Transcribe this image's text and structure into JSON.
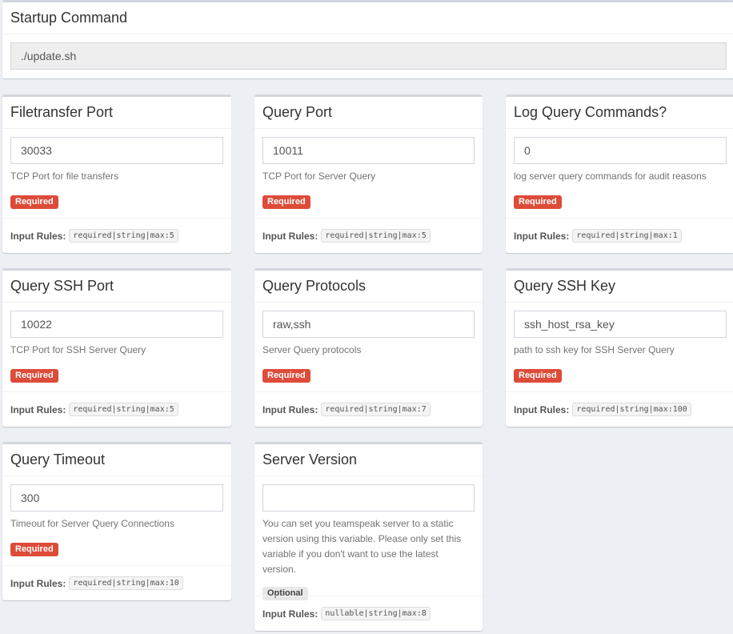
{
  "startup": {
    "title": "Startup Command",
    "value": "./update.sh"
  },
  "variables": [
    {
      "title": "Filetransfer Port",
      "value": "30033",
      "description": "TCP Port for file transfers",
      "badge": "Required",
      "rules_label": "Input Rules:",
      "rules": "required|string|max:5"
    },
    {
      "title": "Query Port",
      "value": "10011",
      "description": "TCP Port for Server Query",
      "badge": "Required",
      "rules_label": "Input Rules:",
      "rules": "required|string|max:5"
    },
    {
      "title": "Log Query Commands?",
      "value": "0",
      "description": "log server query commands for audit reasons",
      "badge": "Required",
      "rules_label": "Input Rules:",
      "rules": "required|string|max:1"
    },
    {
      "title": "Query SSH Port",
      "value": "10022",
      "description": "TCP Port for SSH Server Query",
      "badge": "Required",
      "rules_label": "Input Rules:",
      "rules": "required|string|max:5"
    },
    {
      "title": "Query Protocols",
      "value": "raw,ssh",
      "description": "Server Query protocols",
      "badge": "Required",
      "rules_label": "Input Rules:",
      "rules": "required|string|max:7"
    },
    {
      "title": "Query SSH Key",
      "value": "ssh_host_rsa_key",
      "description": "path to ssh key for SSH Server Query",
      "badge": "Required",
      "rules_label": "Input Rules:",
      "rules": "required|string|max:100"
    },
    {
      "title": "Query Timeout",
      "value": "300",
      "description": "Timeout for Server Query Connections",
      "badge": "Required",
      "rules_label": "Input Rules:",
      "rules": "required|string|max:10"
    },
    {
      "title": "Server Version",
      "value": "",
      "description": "You can set you teamspeak server to a static version using this variable. Please only set this variable if you don't want to use the latest version.",
      "badge": "Optional",
      "rules_label": "Input Rules:",
      "rules": "nullable|string|max:8"
    }
  ]
}
